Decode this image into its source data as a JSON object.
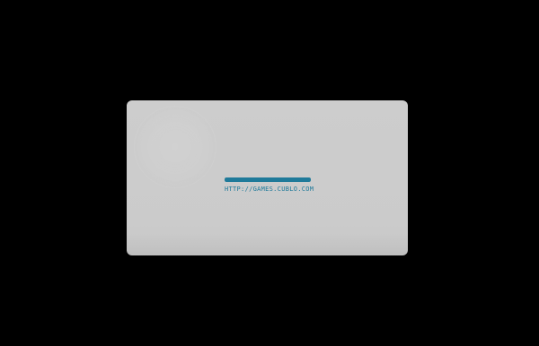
{
  "loader": {
    "url_text": "HTTP://GAMES.CUBLO.COM",
    "progress_fraction": 1.0,
    "accent_color": "#1f7a9a",
    "card_color": "#cdcdcd",
    "background_color": "#000000"
  }
}
